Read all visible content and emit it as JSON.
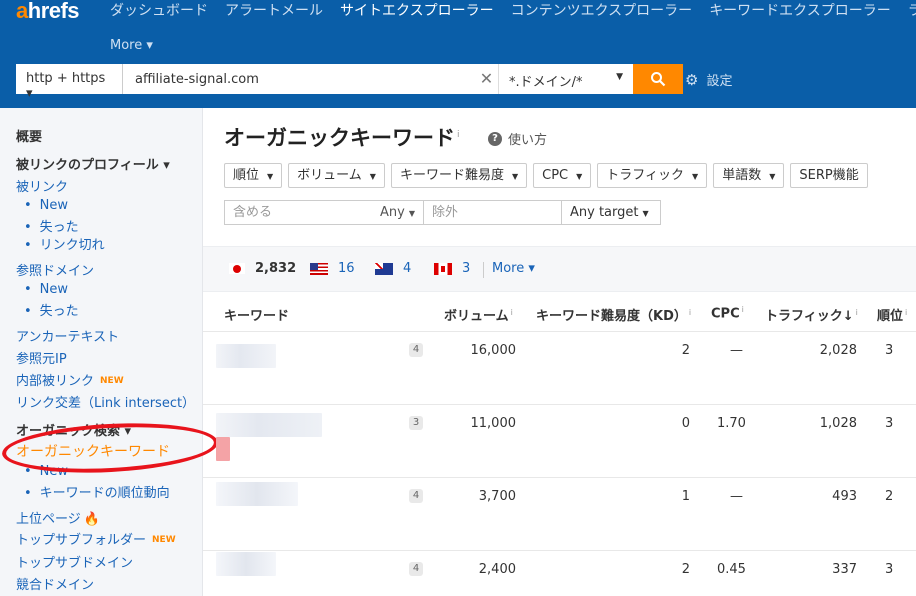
{
  "header": {
    "logo_a": "a",
    "logo_rest": "hrefs",
    "nav": [
      "ダッシュボード",
      "アラートメール",
      "サイトエクスプローラー",
      "コンテンツエクスプローラー",
      "キーワードエクスプローラー",
      "ラ"
    ],
    "more": "More ▾",
    "protocol": "http + https ▾",
    "url_value": "affiliate-signal.com",
    "mode": "*.ドメイン/*",
    "settings": "設定",
    "colors": {
      "bg": "#0a5ea8",
      "accent": "#ff8800"
    }
  },
  "sidebar": {
    "overview": "概要",
    "backlink_profile": "被リンクのプロフィール ▾",
    "backlinks": "被リンク",
    "backlinks_sub": [
      "New",
      "失った",
      "リンク切れ"
    ],
    "ref_domains": "参照ドメイン",
    "ref_domains_sub": [
      "New",
      "失った"
    ],
    "anchors": "アンカーテキスト",
    "ref_ips": "参照元IP",
    "internal_backlinks": "内部被リンク",
    "new_badge": "NEW",
    "link_intersect": "リンク交差（Link intersect）",
    "organic_search": "オーガニック検索 ▾",
    "organic_keywords": "オーガニックキーワード",
    "organic_sub": [
      "New",
      "キーワードの順位動向"
    ],
    "top_pages": "上位ページ",
    "top_subfolders": "トップサブフォルダー",
    "top_subdomains": "トップサブドメイン",
    "competing_domains": "競合ドメイン"
  },
  "main": {
    "title": "オーガニックキーワード",
    "info": "i",
    "howto": "使い方",
    "filters": [
      "順位",
      "ボリューム",
      "キーワード難易度",
      "CPC",
      "トラフィック",
      "単語数",
      "SERP機能"
    ],
    "include_placeholder": "含める",
    "any": "Any",
    "exclude_placeholder": "除外",
    "any_target": "Any target",
    "countries": [
      {
        "code": "jp",
        "count": "2,832"
      },
      {
        "code": "us",
        "count": "16"
      },
      {
        "code": "au",
        "count": "4"
      },
      {
        "code": "ca",
        "count": "3"
      }
    ],
    "country_more": "More ▾",
    "columns": {
      "keyword": "キーワード",
      "volume": "ボリューム",
      "kd": "キーワード難易度（KD）",
      "cpc": "CPC",
      "traffic": "トラフィック↓",
      "position": "順位"
    },
    "rows": [
      {
        "words": "4",
        "volume": "16,000",
        "kd": "2",
        "cpc": "—",
        "traffic": "2,028",
        "position": "3"
      },
      {
        "words": "3",
        "volume": "11,000",
        "kd": "0",
        "cpc": "1.70",
        "traffic": "1,028",
        "position": "3"
      },
      {
        "words": "4",
        "volume": "3,700",
        "kd": "1",
        "cpc": "—",
        "traffic": "493",
        "position": "2"
      },
      {
        "words": "4",
        "volume": "2,400",
        "kd": "2",
        "cpc": "0.45",
        "traffic": "337",
        "position": "3"
      }
    ]
  }
}
